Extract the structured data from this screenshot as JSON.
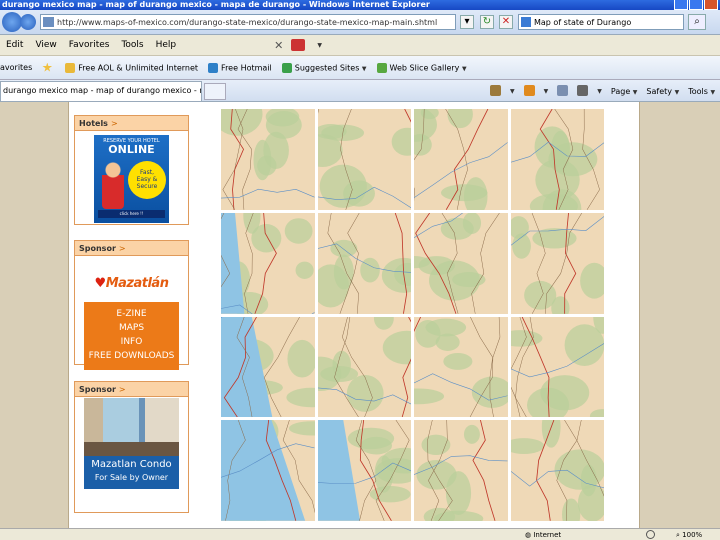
{
  "window": {
    "title": "durango mexico map - map of durango mexico - mapa de durango - Windows Internet Explorer"
  },
  "address_bar": {
    "url": "http://www.maps-of-mexico.com/durango-state-mexico/durango-state-mexico-map-main.shtml",
    "search_text": "Map of state of Durango"
  },
  "menu": {
    "items": [
      "Edit",
      "View",
      "Favorites",
      "Tools",
      "Help"
    ]
  },
  "favorites_bar": {
    "label": "avorites",
    "items": [
      "Free AOL & Unlimited Internet",
      "Free Hotmail",
      "Suggested Sites",
      "Web Slice Gallery"
    ]
  },
  "tab": {
    "title": "durango mexico map - map of durango mexico - mapa..."
  },
  "command_bar": {
    "items": [
      "Page",
      "Safety",
      "Tools"
    ]
  },
  "sidebar": {
    "hotels": {
      "header": "Hotels",
      "arrow": ">",
      "ad": {
        "line1": "RESERVE YOUR HOTEL",
        "line2": "ONLINE",
        "burst": [
          "Fast,",
          "Easy &",
          "Secure"
        ],
        "cta": "click here !!"
      }
    },
    "sponsor1": {
      "header": "Sponsor",
      "arrow": ">",
      "ad": {
        "logo": "Mazatlán",
        "lines": [
          "E-ZINE",
          "MAPS",
          "INFO",
          "FREE DOWNLOADS"
        ]
      }
    },
    "sponsor2": {
      "header": "Sponsor",
      "arrow": ">",
      "ad": {
        "line1": "Mazatlan  Condo",
        "line2": "For Sale by Owner"
      }
    }
  },
  "status_bar": {
    "zone": "Internet",
    "zoom": "100%"
  }
}
